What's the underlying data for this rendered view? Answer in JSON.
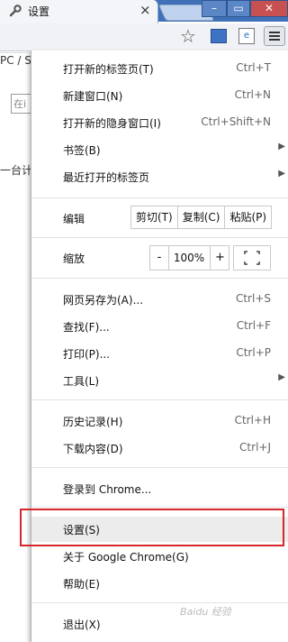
{
  "tab": {
    "title": "设置",
    "icon": "wrench-icon",
    "close": "×"
  },
  "window": {
    "min": "–",
    "max": "▭",
    "close": "✕"
  },
  "toolbar": {
    "star": "☆",
    "ext2": "e"
  },
  "page": {
    "crumb": "PC / S",
    "input": "在i",
    "text": "一台计"
  },
  "menu": {
    "new_tab": {
      "label": "打开新的标签页(T)",
      "shortcut": "Ctrl+T"
    },
    "new_window": {
      "label": "新建窗口(N)",
      "shortcut": "Ctrl+N"
    },
    "incognito": {
      "label": "打开新的隐身窗口(I)",
      "shortcut": "Ctrl+Shift+N"
    },
    "bookmarks": {
      "label": "书签(B)"
    },
    "recent_tabs": {
      "label": "最近打开的标签页"
    },
    "edit": {
      "label": "编辑",
      "cut": "剪切(T)",
      "copy": "复制(C)",
      "paste": "粘贴(P)"
    },
    "zoom": {
      "label": "缩放",
      "minus": "-",
      "value": "100%",
      "plus": "+"
    },
    "save_as": {
      "label": "网页另存为(A)...",
      "shortcut": "Ctrl+S"
    },
    "find": {
      "label": "查找(F)...",
      "shortcut": "Ctrl+F"
    },
    "print": {
      "label": "打印(P)...",
      "shortcut": "Ctrl+P"
    },
    "tools": {
      "label": "工具(L)"
    },
    "history": {
      "label": "历史记录(H)",
      "shortcut": "Ctrl+H"
    },
    "downloads": {
      "label": "下载内容(D)",
      "shortcut": "Ctrl+J"
    },
    "signin": {
      "label": "登录到 Chrome..."
    },
    "settings": {
      "label": "设置(S)"
    },
    "about": {
      "label": "关于 Google Chrome(G)"
    },
    "help": {
      "label": "帮助(E)"
    },
    "exit": {
      "label": "退出(X)"
    }
  },
  "watermark": "Baidu 经验"
}
